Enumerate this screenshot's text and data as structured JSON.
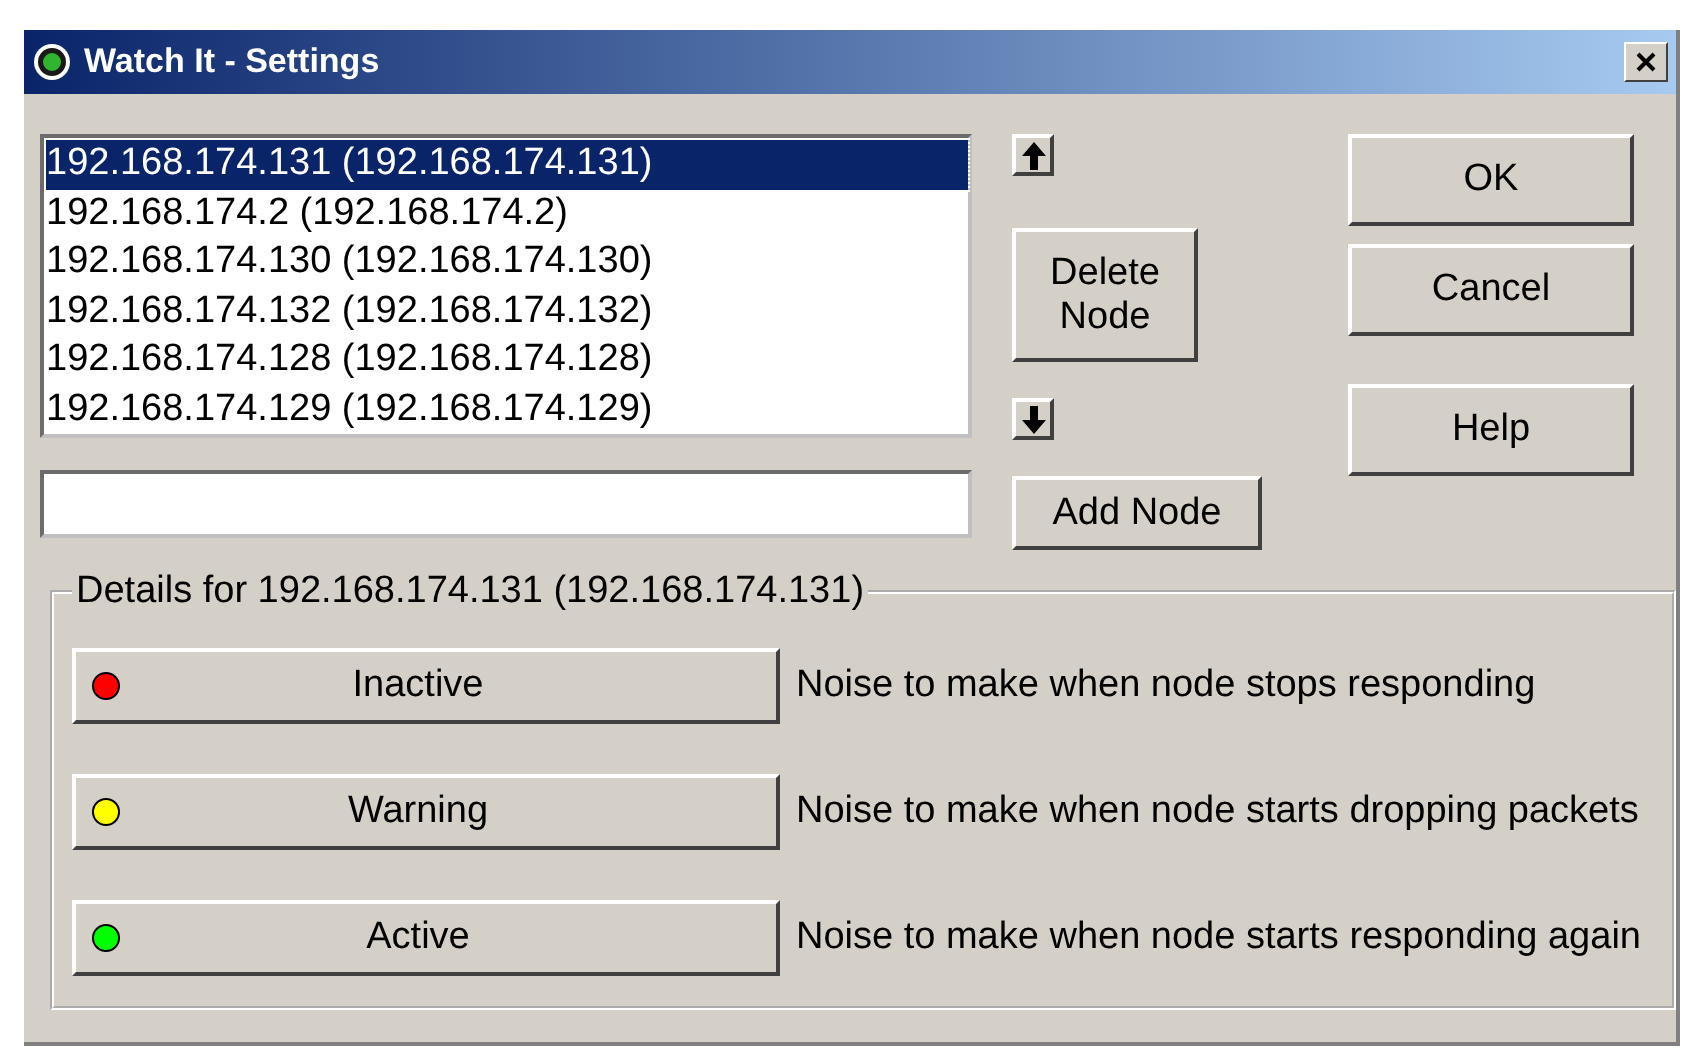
{
  "window": {
    "title": "Watch It - Settings"
  },
  "nodes": [
    {
      "label": "192.168.174.131 (192.168.174.131)",
      "selected": true
    },
    {
      "label": "192.168.174.2 (192.168.174.2)",
      "selected": false
    },
    {
      "label": "192.168.174.130 (192.168.174.130)",
      "selected": false
    },
    {
      "label": "192.168.174.132 (192.168.174.132)",
      "selected": false
    },
    {
      "label": "192.168.174.128 (192.168.174.128)",
      "selected": false
    },
    {
      "label": "192.168.174.129 (192.168.174.129)",
      "selected": false
    }
  ],
  "node_buttons": {
    "delete": "Delete Node",
    "add": "Add Node"
  },
  "dialog_buttons": [
    "OK",
    "Cancel",
    "Help"
  ],
  "details": {
    "title": "Details for 192.168.174.131 (192.168.174.131)",
    "states": [
      {
        "label": "Inactive",
        "color": "#ff0000",
        "description": "Noise to make when node stops responding"
      },
      {
        "label": "Warning",
        "color": "#ffff00",
        "description": "Noise to make when node starts dropping packets"
      },
      {
        "label": "Active",
        "color": "#00ff00",
        "description": "Noise to make when node starts responding again"
      }
    ]
  }
}
